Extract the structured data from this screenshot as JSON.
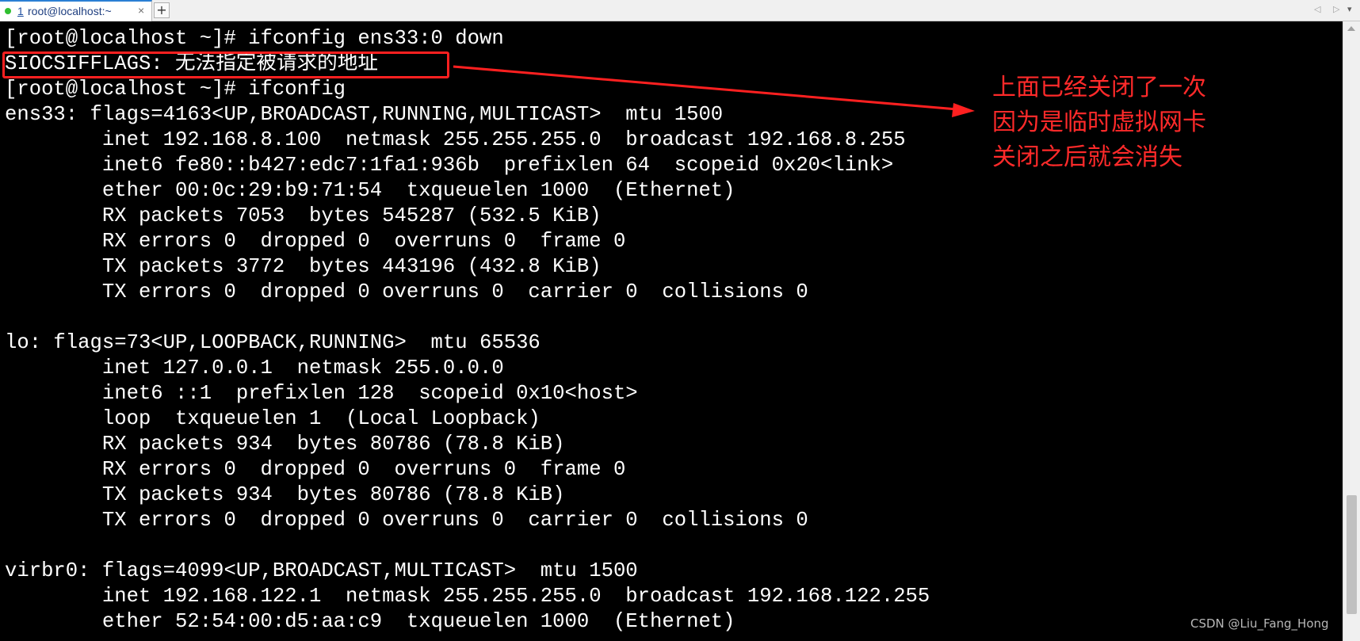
{
  "tab": {
    "index": "1",
    "title": "root@localhost:~",
    "close": "×",
    "add": "+",
    "scroll_left": "◁",
    "scroll_right": "▷",
    "menu": "▾"
  },
  "terminal": {
    "lines": [
      "[root@localhost ~]# ifconfig ens33:0 down",
      "SIOCSIFFLAGS: 无法指定被请求的地址",
      "[root@localhost ~]# ifconfig",
      "ens33: flags=4163<UP,BROADCAST,RUNNING,MULTICAST>  mtu 1500",
      "        inet 192.168.8.100  netmask 255.255.255.0  broadcast 192.168.8.255",
      "        inet6 fe80::b427:edc7:1fa1:936b  prefixlen 64  scopeid 0x20<link>",
      "        ether 00:0c:29:b9:71:54  txqueuelen 1000  (Ethernet)",
      "        RX packets 7053  bytes 545287 (532.5 KiB)",
      "        RX errors 0  dropped 0  overruns 0  frame 0",
      "        TX packets 3772  bytes 443196 (432.8 KiB)",
      "        TX errors 0  dropped 0 overruns 0  carrier 0  collisions 0",
      "",
      "lo: flags=73<UP,LOOPBACK,RUNNING>  mtu 65536",
      "        inet 127.0.0.1  netmask 255.0.0.0",
      "        inet6 ::1  prefixlen 128  scopeid 0x10<host>",
      "        loop  txqueuelen 1  (Local Loopback)",
      "        RX packets 934  bytes 80786 (78.8 KiB)",
      "        RX errors 0  dropped 0  overruns 0  frame 0",
      "        TX packets 934  bytes 80786 (78.8 KiB)",
      "        TX errors 0  dropped 0 overruns 0  carrier 0  collisions 0",
      "",
      "virbr0: flags=4099<UP,BROADCAST,MULTICAST>  mtu 1500",
      "        inet 192.168.122.1  netmask 255.255.255.0  broadcast 192.168.122.255",
      "        ether 52:54:00:d5:aa:c9  txqueuelen 1000  (Ethernet)"
    ]
  },
  "annotation": {
    "lines": [
      "上面已经关闭了一次",
      "因为是临时虚拟网卡",
      "关闭之后就会消失"
    ],
    "color": "#ff2a2a"
  },
  "watermark": "CSDN @Liu_Fang_Hong"
}
